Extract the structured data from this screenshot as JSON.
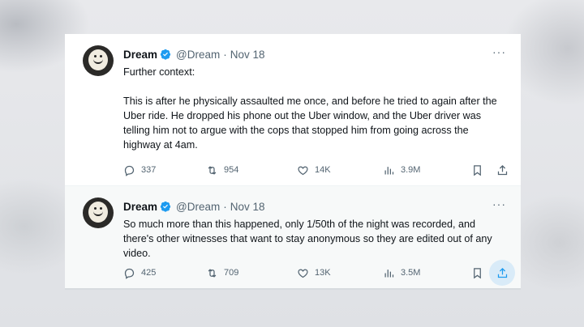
{
  "tweets": [
    {
      "name": "Dream",
      "handle": "@Dream",
      "separator": "·",
      "date": "Nov 18",
      "more": "···",
      "text_lines": [
        "Further context:",
        "This is after he physically assaulted me once, and before he tried to again after the Uber ride. He dropped his phone out the Uber window, and the Uber driver was telling him not to argue with the cops that stopped him from going across the highway at 4am."
      ],
      "replies": "337",
      "retweets": "954",
      "likes": "14K",
      "views": "3.9M"
    },
    {
      "name": "Dream",
      "handle": "@Dream",
      "separator": "·",
      "date": "Nov 18",
      "more": "···",
      "text_lines": [
        "So much more than this happened, only 1/50th of the night was recorded, and there's other witnesses that want to stay anonymous so they are edited out of any video."
      ],
      "replies": "425",
      "retweets": "709",
      "likes": "13K",
      "views": "3.5M"
    }
  ],
  "icons": {
    "verified": "verified-badge-icon",
    "reply": "reply-icon",
    "retweet": "retweet-icon",
    "like": "heart-icon",
    "views": "views-chart-icon",
    "bookmark": "bookmark-icon",
    "share": "share-icon",
    "more": "more-icon"
  },
  "colors": {
    "verified": "#1d9bf0",
    "text": "#0f1419",
    "muted": "#536471",
    "share_highlight": "#d9ebf8"
  }
}
